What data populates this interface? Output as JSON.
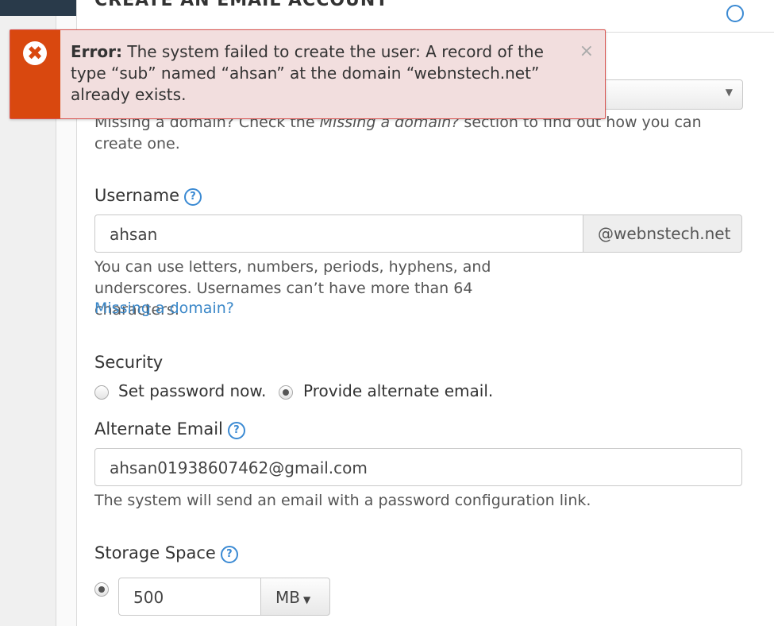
{
  "panel": {
    "title": "CREATE AN EMAIL ACCOUNT"
  },
  "alert": {
    "prefix": "Error:",
    "message": "The system failed to create the user: A record of the type “sub” named “ahsan” at the domain “webnstech.net” already exists.",
    "close": "×",
    "icon": "error-x-icon"
  },
  "domain": {
    "help_pre": "Missing a domain? Check the ",
    "help_em": "Missing a domain?",
    "help_post": " section to find out how you can create one."
  },
  "username": {
    "label": "Username",
    "value": "ahsan",
    "suffix": "@webnstech.net",
    "help": "You can use letters, numbers, periods, hyphens, and underscores. Usernames can’t have more than 64 characters.",
    "link": "Missing a domain?"
  },
  "security": {
    "label": "Security",
    "option_set": "Set password now.",
    "option_alt": "Provide alternate email.",
    "selected": "option_alt"
  },
  "alternate_email": {
    "label": "Alternate Email",
    "value": "ahsan01938607462@gmail.com",
    "help": "The system will send an email with a password configuration link."
  },
  "storage": {
    "label": "Storage Space",
    "value": "500",
    "unit": "MB"
  },
  "colors": {
    "accent": "#3b8ad3",
    "error": "#d9480f",
    "alert_bg": "#f2dede"
  }
}
